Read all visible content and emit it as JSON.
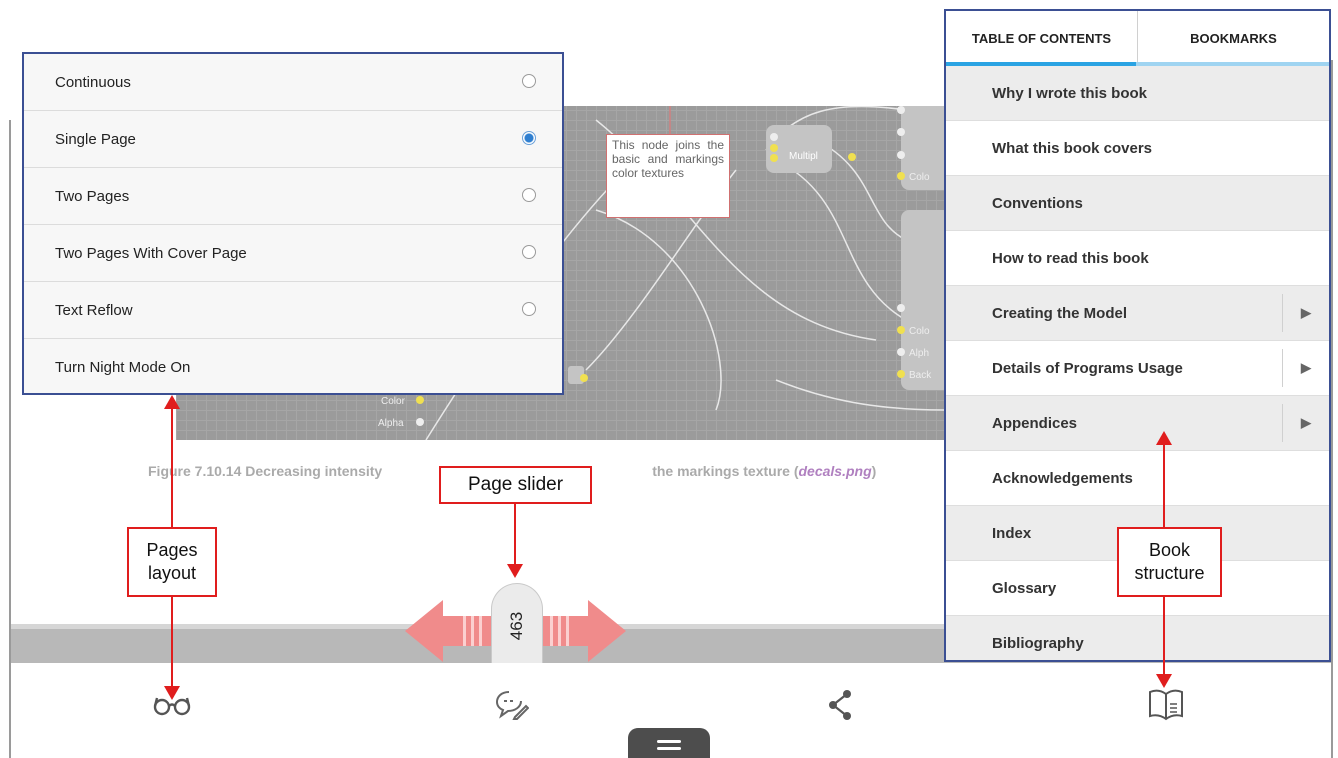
{
  "layout_menu": {
    "items": [
      {
        "label": "Continuous",
        "selected": false
      },
      {
        "label": "Single Page",
        "selected": true
      },
      {
        "label": "Two Pages",
        "selected": false
      },
      {
        "label": "Two Pages With Cover Page",
        "selected": false
      },
      {
        "label": "Text Reflow",
        "selected": false
      },
      {
        "label": "Turn Night Mode On"
      }
    ]
  },
  "toc": {
    "tabs": [
      "TABLE OF CONTENTS",
      "BOOKMARKS"
    ],
    "active_tab": "TABLE OF CONTENTS",
    "items": [
      {
        "label": "Why I wrote this book",
        "expandable": false
      },
      {
        "label": "What this book covers",
        "expandable": false
      },
      {
        "label": "Conventions",
        "expandable": false
      },
      {
        "label": "How to read this book",
        "expandable": false
      },
      {
        "label": "Creating the Model",
        "expandable": true
      },
      {
        "label": "Details of Programs Usage",
        "expandable": true
      },
      {
        "label": "Appendices",
        "expandable": true
      },
      {
        "label": "Acknowledgements",
        "expandable": false
      },
      {
        "label": "Index",
        "expandable": false
      },
      {
        "label": "Glossary",
        "expandable": false
      },
      {
        "label": "Bibliography",
        "expandable": false
      }
    ]
  },
  "page": {
    "note": "This node joins the basic and markings color textures",
    "node_multiply": "Multipl",
    "port_color": "Color",
    "port_alpha": "Alpha",
    "port_colo": "Colo",
    "port_alph": "Alph",
    "port_back": "Back",
    "caption_left": "Figure 7.10.14 Decreasing intensity",
    "caption_right": "the markings texture (",
    "caption_file": "decals.png",
    "caption_end": ")"
  },
  "slider": {
    "page_number": "463"
  },
  "toolbar": {
    "icons": [
      "glasses-icon",
      "comment-edit-icon",
      "share-icon",
      "book-icon",
      "menu-icon"
    ]
  },
  "annotations": {
    "pages_layout": "Pages layout",
    "page_slider": "Page slider",
    "book_structure": "Book structure"
  },
  "colors": {
    "accent": "#2aa3e3",
    "annotation": "#e01d1d",
    "border": "#3b4f93"
  }
}
